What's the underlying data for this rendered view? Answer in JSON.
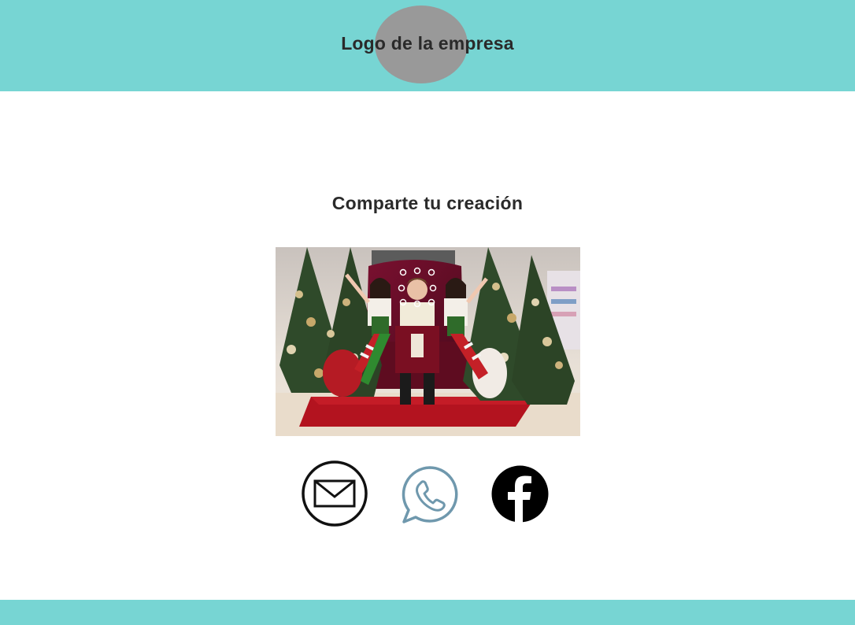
{
  "header": {
    "logo_text": "Logo de la empresa",
    "background_color": "#77d5d3",
    "logo_placeholder_color": "#999999"
  },
  "main": {
    "title": "Comparte tu creación",
    "photo": {
      "scene": "christmas-santa-throne-with-elves"
    }
  },
  "share": {
    "buttons": [
      {
        "icon": "email-icon",
        "color": "#111111"
      },
      {
        "icon": "whatsapp-icon",
        "color": "#6f98ad"
      },
      {
        "icon": "facebook-icon",
        "color": "#000000"
      }
    ]
  },
  "footer": {
    "background_color": "#77d5d3"
  }
}
